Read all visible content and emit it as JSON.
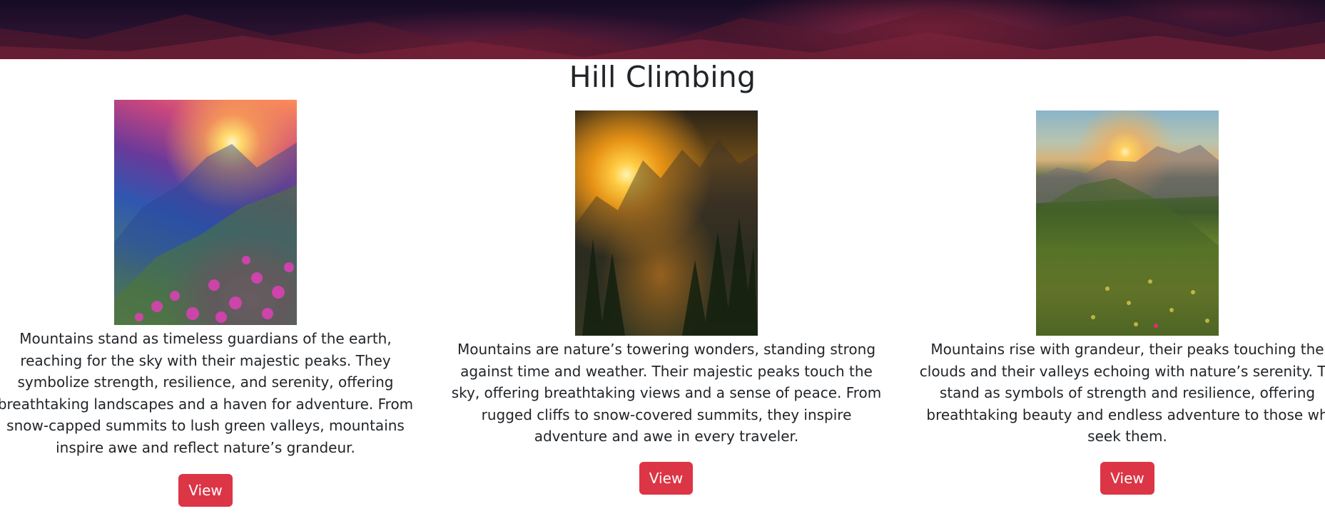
{
  "section": {
    "title": "Hill Climbing"
  },
  "cards": [
    {
      "image_alt": "Sunset over mountain slope with pink flowers",
      "lines": [
        "Mountains stand as timeless guardians of the earth,",
        "reaching for the sky with their majestic peaks. They",
        "symbolize strength, resilience, and serenity, offering",
        "breathtaking landscapes and a haven for adventure. From",
        "snow-capped summits to lush green valleys, mountains",
        "inspire awe and reflect nature’s grandeur."
      ],
      "button_label": "View"
    },
    {
      "image_alt": "Golden sun rays through misty forest and peaks",
      "lines": [
        "Mountains are nature’s towering wonders, standing strong",
        "against time and weather. Their majestic peaks touch the",
        "sky, offering breathtaking views and a sense of peace. From",
        "rugged cliffs to snow-covered summits, they inspire",
        "adventure and awe in every traveler."
      ],
      "button_label": "View"
    },
    {
      "image_alt": "Sunrise over grassy ridge with wildflowers",
      "lines": [
        "Mountains rise with grandeur, their peaks touching the",
        "clouds and their valleys echoing with nature’s serenity. Th",
        "stand as symbols of strength and resilience, offering",
        "breathtaking beauty and endless adventure to those wh",
        "seek them."
      ],
      "button_label": "View"
    }
  ],
  "colors": {
    "button_bg": "#dc3545",
    "button_text": "#ffffff",
    "title_text": "#212529"
  }
}
